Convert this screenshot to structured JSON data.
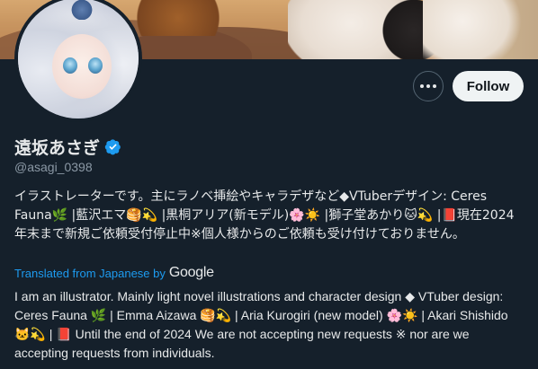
{
  "profile": {
    "display_name": "遠坂あさぎ",
    "handle": "@asagi_0398",
    "verified": true,
    "verified_color": "#1d9bf0"
  },
  "actions": {
    "more_icon": "ellipsis-icon",
    "follow_label": "Follow"
  },
  "bio": {
    "original": "イラストレーターです。主にラノベ挿絵やキャラデザなど◆VTuberデザイン: Ceres Fauna🌿 |藍沢エマ🥞💫 |黒桐アリア(新モデル)🌸☀️ |獅子堂あかり🐱💫 |📕現在2024年末まで新規ご依頼受付停止中※個人様からのご依頼も受け付けておりません。",
    "translated_from": "Translated from Japanese by",
    "translator": "Google",
    "translation": "I am an illustrator. Mainly light novel illustrations and character design ◆ VTuber design: Ceres Fauna 🌿 | Emma Aizawa 🥞💫 | Aria Kurogiri (new model) 🌸☀️ | Akari Shishido 🐱💫 | 📕 Until the end of 2024 We are not accepting new requests ※ nor are we accepting requests from individuals."
  },
  "colors": {
    "background": "#15202b",
    "text": "#e7e9ea",
    "secondary_text": "#8b98a5",
    "link": "#1d9bf0",
    "follow_button_bg": "#eff3f4"
  }
}
